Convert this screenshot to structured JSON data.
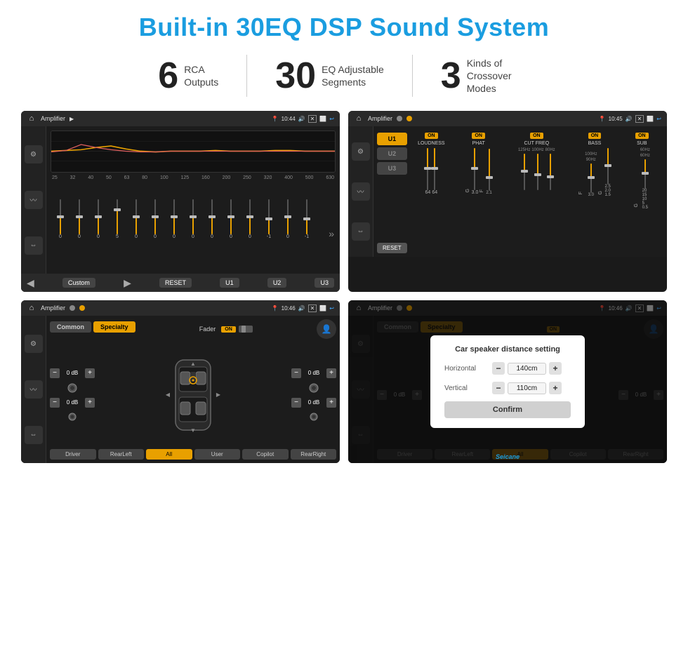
{
  "page": {
    "title": "Built-in 30EQ DSP Sound System",
    "background": "#ffffff"
  },
  "features": [
    {
      "number": "6",
      "text": "RCA\nOutputs"
    },
    {
      "number": "30",
      "text": "EQ Adjustable\nSegments"
    },
    {
      "number": "3",
      "text": "Kinds of\nCrossover Modes"
    }
  ],
  "screen1": {
    "topbar": {
      "title": "Amplifier",
      "time": "10:44"
    },
    "eq_labels": [
      "25",
      "32",
      "40",
      "50",
      "63",
      "80",
      "100",
      "125",
      "160",
      "200",
      "250",
      "320",
      "400",
      "500",
      "630"
    ],
    "eq_values": [
      "0",
      "0",
      "0",
      "5",
      "0",
      "0",
      "0",
      "0",
      "0",
      "0",
      "0",
      "-1",
      "0",
      "-1"
    ],
    "bottom_buttons": [
      "Custom",
      "RESET",
      "U1",
      "U2",
      "U3"
    ]
  },
  "screen2": {
    "topbar": {
      "title": "Amplifier",
      "time": "10:45"
    },
    "presets": [
      "U1",
      "U2",
      "U3"
    ],
    "channels": [
      {
        "name": "LOUDNESS",
        "on": true
      },
      {
        "name": "PHAT",
        "on": true
      },
      {
        "name": "CUT FREQ",
        "on": true
      },
      {
        "name": "BASS",
        "on": true
      },
      {
        "name": "SUB",
        "on": true
      }
    ],
    "reset_label": "RESET"
  },
  "screen3": {
    "topbar": {
      "title": "Amplifier",
      "time": "10:46"
    },
    "tabs": [
      "Common",
      "Specialty"
    ],
    "fader_label": "Fader",
    "fader_on": "ON",
    "zones": [
      {
        "label": "",
        "value": "0 dB"
      },
      {
        "label": "",
        "value": "0 dB"
      },
      {
        "label": "",
        "value": "0 dB"
      },
      {
        "label": "",
        "value": "0 dB"
      }
    ],
    "bottom_buttons": [
      "Driver",
      "RearLeft",
      "All",
      "User",
      "Copilot",
      "RearRight"
    ]
  },
  "screen4": {
    "topbar": {
      "title": "Amplifier",
      "time": "10:46"
    },
    "tabs": [
      "Common",
      "Specialty"
    ],
    "dialog": {
      "title": "Car speaker distance setting",
      "horizontal_label": "Horizontal",
      "horizontal_value": "140cm",
      "vertical_label": "Vertical",
      "vertical_value": "110cm",
      "confirm_label": "Confirm"
    },
    "bottom_buttons": [
      "Driver",
      "RearLeft",
      "Copilot",
      "RearRight"
    ],
    "watermark": "Seicane"
  }
}
